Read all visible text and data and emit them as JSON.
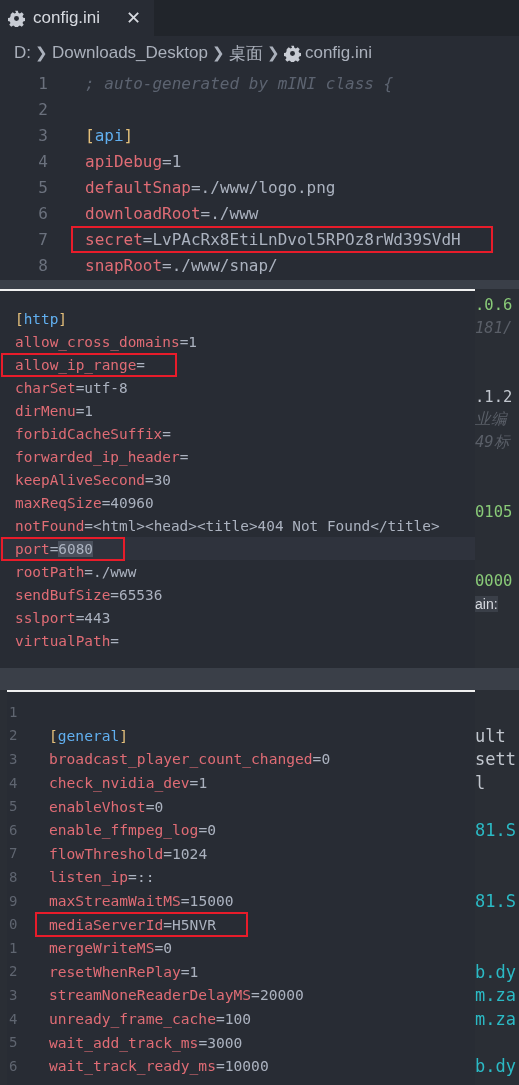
{
  "editor": {
    "tab": {
      "label": "config.ini",
      "close": "✕",
      "selected": true
    },
    "breadcrumb": {
      "separator": "❯",
      "items": [
        "D:",
        "Downloads_Desktop",
        "桌面",
        "config.ini"
      ]
    },
    "lines": [
      {
        "number": "1",
        "kind": "comment",
        "text": "; auto-generated by mINI class {"
      },
      {
        "number": "2",
        "kind": "blank"
      },
      {
        "number": "3",
        "kind": "section",
        "text": "[api]"
      },
      {
        "number": "4",
        "kind": "pair",
        "text": "apiDebug=1",
        "boxed": false
      },
      {
        "number": "5",
        "kind": "pair",
        "text": "defaultSnap=./www/logo.png",
        "boxed": false
      },
      {
        "number": "6",
        "kind": "pair",
        "text": "downloadRoot=./www",
        "boxed": false
      },
      {
        "number": "7",
        "kind": "pair",
        "text": "secret=LvPAcRx8EtiLnDvol5RPOz8rWd39SVdH",
        "boxed": true
      },
      {
        "number": "8",
        "kind": "pair",
        "text": "snapRoot=./www/snap/",
        "boxed": false
      }
    ]
  },
  "http_panel": {
    "lines": [
      {
        "kind": "section",
        "text": "[http]",
        "aside": {
          "text": ".0.6",
          "kind": "number"
        }
      },
      {
        "kind": "pair",
        "text": "allow_cross_domains=1",
        "boxed": false,
        "current": false,
        "aside": {
          "text": "181/",
          "kind": "comment"
        }
      },
      {
        "kind": "pair",
        "text": "allow_ip_range=",
        "boxed": true,
        "current": false
      },
      {
        "kind": "pair",
        "text": "charSet=utf-8",
        "boxed": false,
        "current": false
      },
      {
        "kind": "pair",
        "text": "dirMenu=1",
        "boxed": false,
        "current": false,
        "aside": {
          "text": ".1.2",
          "kind": "plain"
        }
      },
      {
        "kind": "pair",
        "text": "forbidCacheSuffix=",
        "boxed": false,
        "current": false,
        "aside": {
          "text": "业编",
          "kind": "comment"
        }
      },
      {
        "kind": "pair",
        "text": "forwarded_ip_header=",
        "boxed": false,
        "current": false,
        "aside": {
          "text": "49标",
          "kind": "comment"
        }
      },
      {
        "kind": "pair",
        "text": "keepAliveSecond=30",
        "boxed": false,
        "current": false
      },
      {
        "kind": "pair",
        "text": "maxReqSize=40960",
        "boxed": false,
        "current": false
      },
      {
        "kind": "pair",
        "text": "notFound=<html><head><title>404 Not Found</title>",
        "boxed": false,
        "current": false,
        "aside": {
          "text": "0105",
          "kind": "number"
        }
      },
      {
        "kind": "pair",
        "text": "port=6080",
        "boxed": true,
        "current": true,
        "value_selected": true
      },
      {
        "kind": "pair",
        "text": "rootPath=./www",
        "boxed": false,
        "current": false
      },
      {
        "kind": "pair",
        "text": "sendBufSize=65536",
        "boxed": false,
        "current": false,
        "aside": {
          "text": "0000",
          "kind": "number"
        }
      },
      {
        "kind": "pair",
        "text": "sslport=443",
        "boxed": false,
        "current": false,
        "aside": {
          "text": "ain:",
          "kind": "status"
        }
      },
      {
        "kind": "pair",
        "text": "virtualPath=",
        "boxed": false,
        "current": false
      }
    ]
  },
  "general_panel": {
    "lines": [
      {
        "number": "1",
        "kind": "blank"
      },
      {
        "number": "2",
        "kind": "section",
        "text": "[general]",
        "aside": {
          "text": "ult",
          "kind": "plain"
        }
      },
      {
        "number": "3",
        "kind": "pair",
        "text": "broadcast_player_count_changed=0",
        "boxed": false,
        "aside": {
          "text": "sett",
          "kind": "plain"
        }
      },
      {
        "number": "4",
        "kind": "pair",
        "text": "check_nvidia_dev=1",
        "boxed": false,
        "aside": {
          "text": "l",
          "kind": "plain"
        }
      },
      {
        "number": "5",
        "kind": "pair",
        "text": "enableVhost=0",
        "boxed": false
      },
      {
        "number": "6",
        "kind": "pair",
        "text": "enable_ffmpeg_log=0",
        "boxed": false,
        "aside": {
          "text": "81.S",
          "kind": "link"
        }
      },
      {
        "number": "7",
        "kind": "pair",
        "text": "flowThreshold=1024",
        "boxed": false
      },
      {
        "number": "8",
        "kind": "pair",
        "text": "listen_ip=::",
        "boxed": false
      },
      {
        "number": "9",
        "kind": "pair",
        "text": "maxStreamWaitMS=15000",
        "boxed": false,
        "aside": {
          "text": "81.S",
          "kind": "link"
        }
      },
      {
        "number": "0",
        "kind": "pair",
        "text": "mediaServerId=H5NVR",
        "boxed": true
      },
      {
        "number": "1",
        "kind": "pair",
        "text": "mergeWriteMS=0",
        "boxed": false
      },
      {
        "number": "2",
        "kind": "pair",
        "text": "resetWhenRePlay=1",
        "boxed": false,
        "aside": {
          "text": "b.dy",
          "kind": "link"
        }
      },
      {
        "number": "3",
        "kind": "pair",
        "text": "streamNoneReaderDelayMS=20000",
        "boxed": false,
        "aside": {
          "text": "m.za",
          "kind": "link"
        }
      },
      {
        "number": "4",
        "kind": "pair",
        "text": "unready_frame_cache=100",
        "boxed": false,
        "aside": {
          "text": "m.za",
          "kind": "link"
        }
      },
      {
        "number": "5",
        "kind": "pair",
        "text": "wait_add_track_ms=3000",
        "boxed": false
      },
      {
        "number": "6",
        "kind": "pair",
        "text": "wait_track_ready_ms=10000",
        "boxed": false,
        "aside": {
          "text": "b.dy",
          "kind": "link"
        }
      }
    ]
  }
}
